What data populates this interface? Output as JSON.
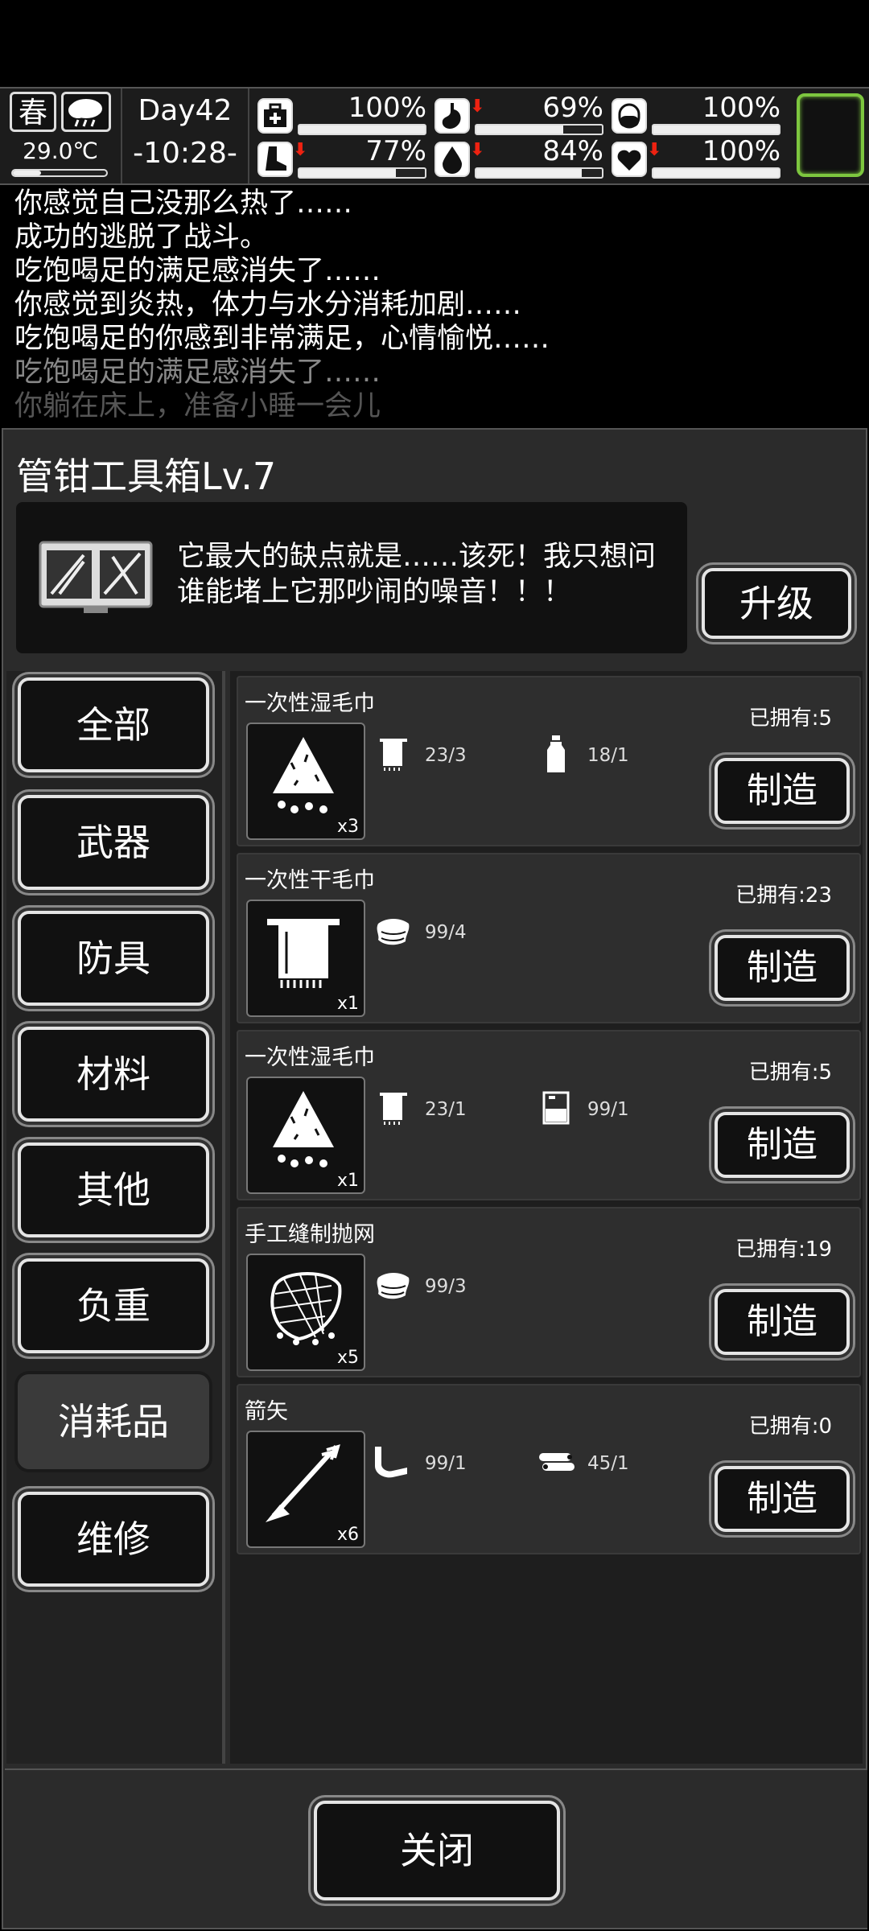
{
  "status": {
    "season": "春",
    "temperature": "29.0℃",
    "temperature_level": 0.3,
    "day": "Day42",
    "time": "-10:28-",
    "stats": [
      {
        "name": "health",
        "icon": "medkit-icon",
        "percent": "100%",
        "level": 1.0,
        "falling": false
      },
      {
        "name": "hunger",
        "icon": "stomach-icon",
        "percent": "69%",
        "level": 0.69,
        "falling": true
      },
      {
        "name": "energy",
        "icon": "pill-icon",
        "percent": "100%",
        "level": 1.0,
        "falling": false
      },
      {
        "name": "stamina",
        "icon": "boot-icon",
        "percent": "77%",
        "level": 0.77,
        "falling": true
      },
      {
        "name": "thirst",
        "icon": "water-drop-icon",
        "percent": "84%",
        "level": 0.84,
        "falling": true
      },
      {
        "name": "mood",
        "icon": "heart-icon",
        "percent": "100%",
        "level": 1.0,
        "falling": true
      }
    ]
  },
  "log": [
    "你感觉自己没那么热了……",
    "成功的逃脱了战斗。",
    "吃饱喝足的满足感消失了……",
    "你感觉到炎热，体力与水分消耗加剧……",
    "吃饱喝足的你感到非常满足，心情愉悦……",
    "吃饱喝足的满足感消失了……",
    "你躺在床上，准备小睡一会儿"
  ],
  "panel": {
    "title": "管钳工具箱Lv.7",
    "description": "它最大的缺点就是……该死！我只想问谁能堵上它那吵闹的噪音！！！",
    "upgrade_label": "升级",
    "close_label": "关闭"
  },
  "categories": [
    {
      "label": "全部",
      "active": false
    },
    {
      "label": "武器",
      "active": false
    },
    {
      "label": "防具",
      "active": false
    },
    {
      "label": "材料",
      "active": false
    },
    {
      "label": "其他",
      "active": false
    },
    {
      "label": "负重",
      "active": false
    },
    {
      "label": "消耗品",
      "active": true
    },
    {
      "label": "维修",
      "active": false
    }
  ],
  "recipes": [
    {
      "name": "一次性湿毛巾",
      "owned": "已拥有:5",
      "qty": "x3",
      "icon": "wet-towel-icon",
      "materials": [
        {
          "icon": "towel-rack-icon",
          "amount": "23/3"
        },
        {
          "icon": "water-bottle-icon",
          "amount": "18/1"
        }
      ],
      "make_label": "制造"
    },
    {
      "name": "一次性干毛巾",
      "owned": "已拥有:23",
      "qty": "x1",
      "icon": "dry-towel-icon",
      "materials": [
        {
          "icon": "cloth-icon",
          "amount": "99/4"
        }
      ],
      "make_label": "制造"
    },
    {
      "name": "一次性湿毛巾",
      "owned": "已拥有:5",
      "qty": "x1",
      "icon": "wet-towel-icon",
      "materials": [
        {
          "icon": "towel-rack-icon",
          "amount": "23/1"
        },
        {
          "icon": "water-container-icon",
          "amount": "99/1"
        }
      ],
      "make_label": "制造"
    },
    {
      "name": "手工缝制抛网",
      "owned": "已拥有:19",
      "qty": "x5",
      "icon": "cast-net-icon",
      "materials": [
        {
          "icon": "cloth-icon",
          "amount": "99/3"
        }
      ],
      "make_label": "制造"
    },
    {
      "name": "箭矢",
      "owned": "已拥有:0",
      "qty": "x6",
      "icon": "arrow-icon",
      "materials": [
        {
          "icon": "scrap-metal-icon",
          "amount": "99/1"
        },
        {
          "icon": "wood-logs-icon",
          "amount": "45/1"
        }
      ],
      "make_label": "制造"
    }
  ]
}
